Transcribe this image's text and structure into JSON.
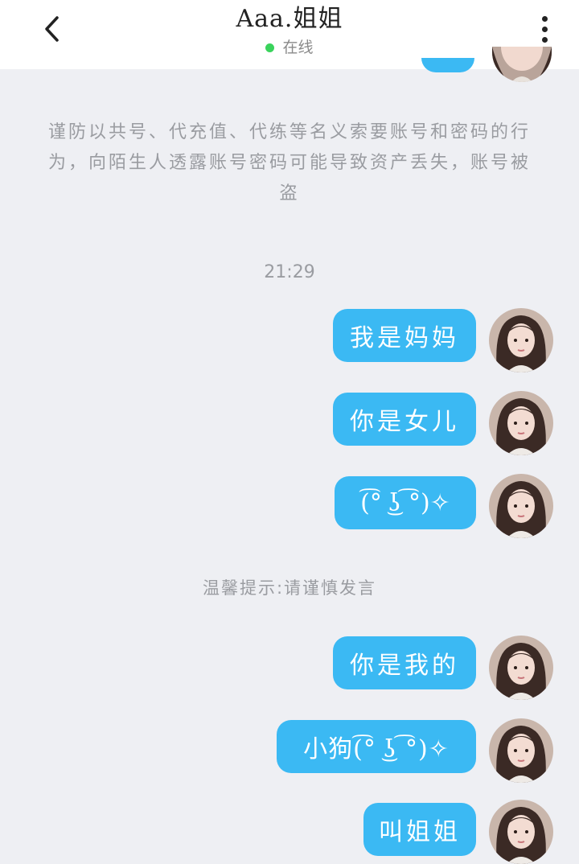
{
  "header": {
    "title": "Aaa.姐姐",
    "status": "在线"
  },
  "notice": "谨防以共号、代充值、代练等名义索要账号和密码的行为，向陌生人透露账号密码可能导致资产丢失，账号被盗",
  "time": "21:29",
  "hint": "温馨提示:请谨慎发言",
  "messages": [
    {
      "text": "我是妈妈"
    },
    {
      "text": "你是女儿"
    },
    {
      "text": "(͡° ͜ʖ ͡°)✧"
    },
    {
      "text": "你是我的"
    },
    {
      "text": "小狗(͡° ͜ʖ ͡°)✧"
    },
    {
      "text": "叫姐姐"
    }
  ],
  "colors": {
    "bubble": "#3bb9f3",
    "online": "#3ad35c",
    "background": "#eeeff3"
  },
  "icons": {
    "back": "chevron-left-icon",
    "more": "vertical-dots-icon"
  }
}
